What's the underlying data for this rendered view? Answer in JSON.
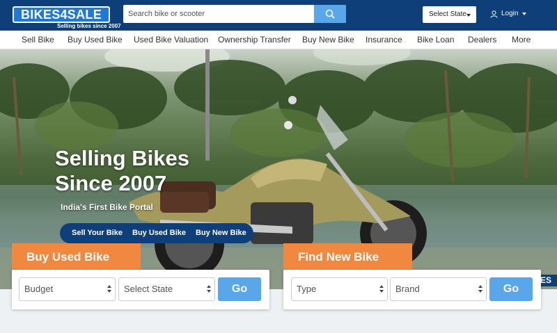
{
  "header": {
    "logo_text": "BIKES4SALE",
    "logo_tagline": "Selling bikes since 2007",
    "search_placeholder": "Search bike or scooter",
    "state_select": "Select State",
    "login": "Login"
  },
  "nav": {
    "items": [
      "Sell Bike",
      "Buy Used Bike",
      "Used Bike Valuation",
      "Ownership Transfer",
      "Buy New Bike",
      "Insurance",
      "Bike Loan",
      "Dealers",
      "More"
    ]
  },
  "hero": {
    "title_line1": "Selling Bikes",
    "title_line2": "Since 2007",
    "subtitle": "India's First Bike Portal",
    "actions": [
      "Sell Your Bike",
      "Buy Used Bike",
      "Buy New Bike"
    ],
    "badge": "ES"
  },
  "used_search": {
    "tab": "Buy Used Bike",
    "budget": "Budget",
    "state": "Select State",
    "go": "Go"
  },
  "new_search": {
    "tab": "Find New Bike",
    "type": "Type",
    "brand": "Brand",
    "go": "Go"
  },
  "colors": {
    "brand_navy": "#0f3f78",
    "accent_orange": "#f0883f",
    "button_blue": "#5aa6ea"
  }
}
